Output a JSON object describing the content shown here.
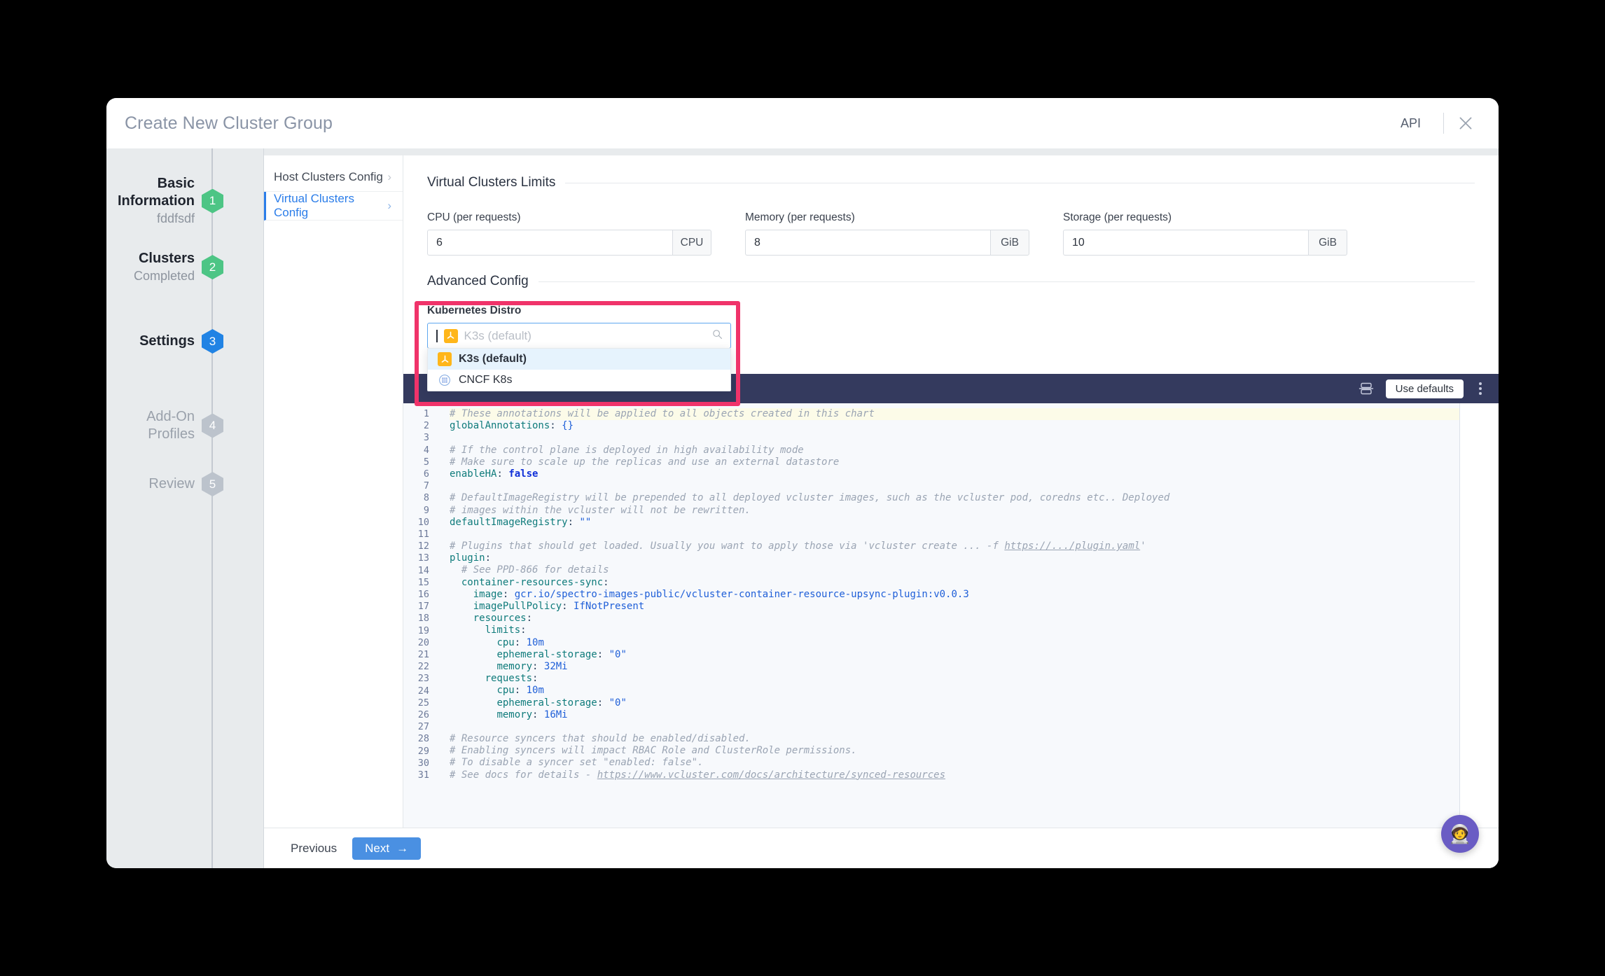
{
  "window": {
    "title": "Create New Cluster Group",
    "api_label": "API",
    "close_icon": "close-icon"
  },
  "stepper": {
    "steps": [
      {
        "name": "Basic Information",
        "sub": "fddfsdf",
        "number": "1",
        "state": "done"
      },
      {
        "name": "Clusters",
        "sub": "Completed",
        "number": "2",
        "state": "done"
      },
      {
        "name": "Settings",
        "sub": "",
        "number": "3",
        "state": "current"
      },
      {
        "name": "Add-On Profiles",
        "sub": "",
        "number": "4",
        "state": "todo"
      },
      {
        "name": "Review",
        "sub": "",
        "number": "5",
        "state": "todo"
      }
    ]
  },
  "subnav": {
    "items": [
      {
        "label": "Host Clusters Config",
        "active": false
      },
      {
        "label": "Virtual Clusters Config",
        "active": true
      }
    ]
  },
  "limits": {
    "section_title": "Virtual Clusters Limits",
    "cpu": {
      "label": "CPU (per requests)",
      "value": "6",
      "unit": "CPU"
    },
    "memory": {
      "label": "Memory (per requests)",
      "value": "8",
      "unit": "GiB"
    },
    "storage": {
      "label": "Storage (per requests)",
      "value": "10",
      "unit": "GiB"
    }
  },
  "advanced": {
    "section_title": "Advanced Config",
    "distro_label": "Kubernetes Distro",
    "distro_placeholder": "K3s (default)",
    "search_icon": "search-icon",
    "options": [
      {
        "label": "K3s (default)",
        "icon": "k3s-icon",
        "selected": true
      },
      {
        "label": "CNCF K8s",
        "icon": "cncf-k8s-icon",
        "selected": false
      }
    ]
  },
  "editor": {
    "use_defaults_label": "Use defaults",
    "fold_icon": "fold-icon",
    "menu_icon": "kebab-menu-icon",
    "line_numbers": [
      "1",
      "2",
      "3",
      "4",
      "5",
      "6",
      "7",
      "8",
      "9",
      "10",
      "11",
      "12",
      "13",
      "14",
      "15",
      "16",
      "17",
      "18",
      "19",
      "20",
      "21",
      "22",
      "23",
      "24",
      "25",
      "26",
      "27",
      "28",
      "29",
      "30",
      "31"
    ],
    "lines": [
      "# These annotations will be applied to all objects created in this chart",
      "globalAnnotations: {}",
      "",
      "# If the control plane is deployed in high availability mode",
      "# Make sure to scale up the replicas and use an external datastore",
      "enableHA: false",
      "",
      "# DefaultImageRegistry will be prepended to all deployed vcluster images, such as the vcluster pod, coredns etc.. Deployed",
      "# images within the vcluster will not be rewritten.",
      "defaultImageRegistry: \"\"",
      "",
      "# Plugins that should get loaded. Usually you want to apply those via 'vcluster create ... -f https://.../plugin.yaml'",
      "plugin:",
      "  # See PPD-866 for details",
      "  container-resources-sync:",
      "    image: gcr.io/spectro-images-public/vcluster-container-resource-upsync-plugin:v0.0.3",
      "    imagePullPolicy: IfNotPresent",
      "    resources:",
      "      limits:",
      "        cpu: 10m",
      "        ephemeral-storage: \"0\"",
      "        memory: 32Mi",
      "      requests:",
      "        cpu: 10m",
      "        ephemeral-storage: \"0\"",
      "        memory: 16Mi",
      "",
      "# Resource syncers that should be enabled/disabled.",
      "# Enabling syncers will impact RBAC Role and ClusterRole permissions.",
      "# To disable a syncer set \"enabled: false\".",
      "# See docs for details - https://www.vcluster.com/docs/architecture/synced-resources"
    ]
  },
  "footer": {
    "previous_label": "Previous",
    "next_label": "Next",
    "next_arrow": "→"
  },
  "fab": {
    "icon": "astronaut-icon",
    "glyph": "🧑‍🚀",
    "color": "#6a5cc4"
  },
  "colors": {
    "accent_blue": "#2b7de9",
    "highlight_pink": "#f0336a",
    "step_done_green": "#4dc585",
    "step_current_blue": "#2183e4",
    "editor_header": "#343a5e"
  }
}
